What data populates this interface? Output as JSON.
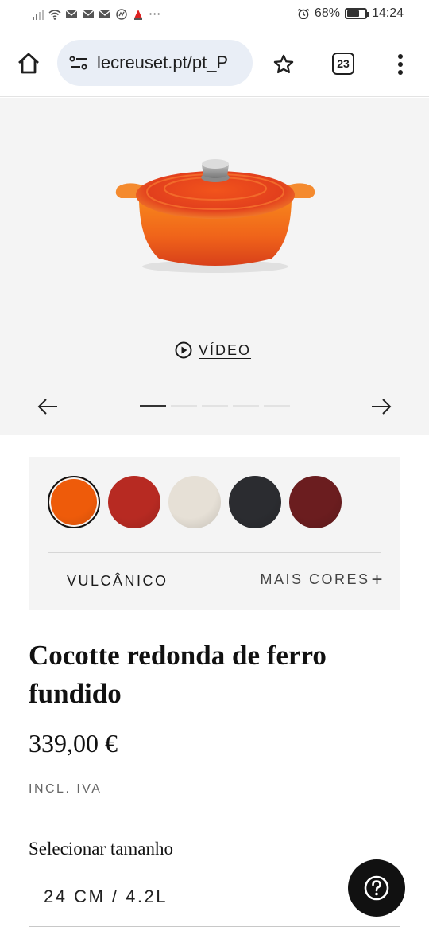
{
  "status_bar": {
    "battery_percent": "68%",
    "battery_level": 0.68,
    "time": "14:24",
    "overflow": "···"
  },
  "browser": {
    "url": "lecreuset.pt/pt_P",
    "tab_count": "23"
  },
  "gallery": {
    "video_label": "VÍDEO",
    "slide_count": 5,
    "active_slide": 1
  },
  "colors": {
    "swatches": [
      {
        "name": "flame-orange",
        "color": "#ee5b0a",
        "selected": true
      },
      {
        "name": "cerise-red",
        "color": "#b72a22",
        "selected": false
      },
      {
        "name": "meringue-cream",
        "color": "#e6e0d6",
        "selected": false
      },
      {
        "name": "black-onyx",
        "color": "#2b2c30",
        "selected": false
      },
      {
        "name": "garnet",
        "color": "#6b1d1f",
        "selected": false
      }
    ],
    "selected_name": "VULCÂNICO",
    "more_label": "MAIS CORES"
  },
  "product": {
    "title": "Cocotte redonda de ferro fundido",
    "price": "339,00 €",
    "tax_note": "INCL. IVA",
    "size_label": "Selecionar tamanho",
    "size_value": "24 CM / 4.2L"
  },
  "accent": {
    "flame": "#ee5b0a",
    "dark": "#111111"
  }
}
